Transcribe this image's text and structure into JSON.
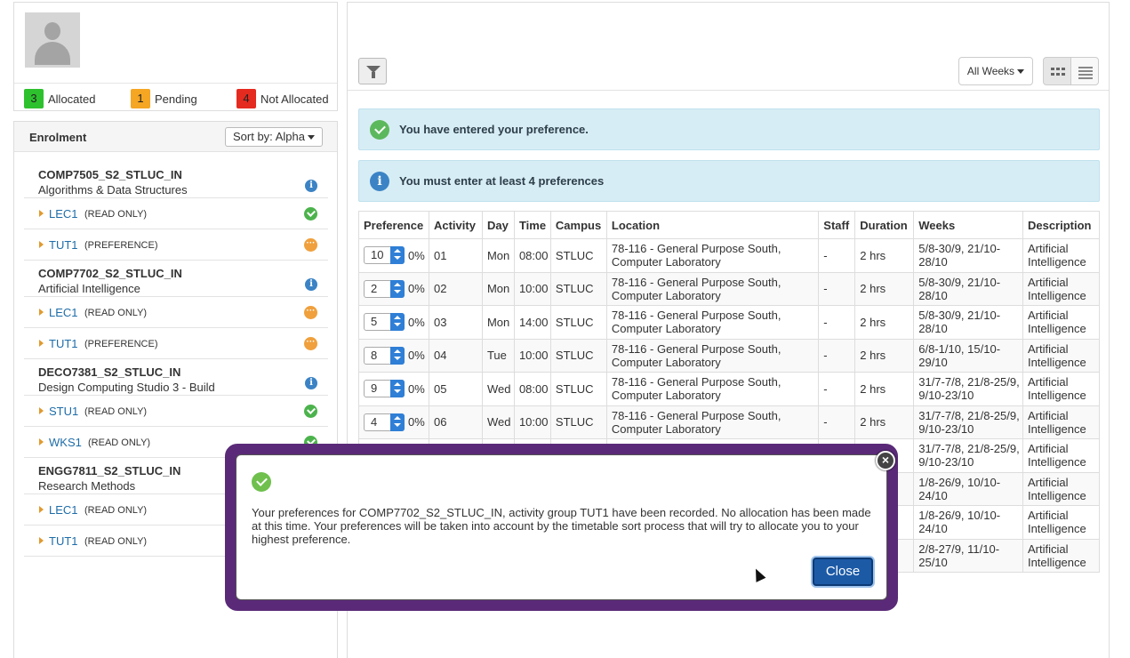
{
  "legend": {
    "allocated": {
      "count": "3",
      "label": "Allocated",
      "color": "#2ec12e"
    },
    "pending": {
      "count": "1",
      "label": "Pending",
      "color": "#f5a623"
    },
    "not_allocated": {
      "count": "4",
      "label": "Not Allocated",
      "color": "#e52a1f"
    }
  },
  "enrolment": {
    "title": "Enrolment",
    "sort_label": "Sort by: Alpha",
    "courses": [
      {
        "code": "COMP7505_S2_STLUC_IN",
        "name": "Algorithms & Data Structures",
        "activities": [
          {
            "name": "LEC1",
            "mode": "(READ ONLY)",
            "status": "allocated"
          },
          {
            "name": "TUT1",
            "mode": "(PREFERENCE)",
            "status": "pending"
          }
        ]
      },
      {
        "code": "COMP7702_S2_STLUC_IN",
        "name": "Artificial Intelligence",
        "activities": [
          {
            "name": "LEC1",
            "mode": "(READ ONLY)",
            "status": "pending"
          },
          {
            "name": "TUT1",
            "mode": "(PREFERENCE)",
            "status": "pending"
          }
        ]
      },
      {
        "code": "DECO7381_S2_STLUC_IN",
        "name": "Design Computing Studio 3 - Build",
        "activities": [
          {
            "name": "STU1",
            "mode": "(READ ONLY)",
            "status": "allocated"
          },
          {
            "name": "WKS1",
            "mode": "(READ ONLY)",
            "status": "allocated"
          }
        ]
      },
      {
        "code": "ENGG7811_S2_STLUC_IN",
        "name": "Research Methods",
        "activities": [
          {
            "name": "LEC1",
            "mode": "(READ ONLY)",
            "status": "allocated"
          },
          {
            "name": "TUT1",
            "mode": "(READ ONLY)",
            "status": "allocated"
          }
        ]
      }
    ]
  },
  "toolbar": {
    "weeks_label": "All Weeks"
  },
  "alerts": {
    "success": "You have entered your preference.",
    "info": "You must enter at least 4 preferences"
  },
  "table": {
    "headers": [
      "Preference",
      "Activity",
      "Day",
      "Time",
      "Campus",
      "Location",
      "Staff",
      "Duration",
      "Weeks",
      "Description"
    ],
    "rows": [
      {
        "pref": "10",
        "pct": "0%",
        "activity": "01",
        "day": "Mon",
        "time": "08:00",
        "campus": "STLUC",
        "location": "78-116 - General Purpose South, Computer Laboratory",
        "staff": "-",
        "duration": "2 hrs",
        "weeks": "5/8-30/9, 21/10-28/10",
        "desc": "Artificial Intelligence"
      },
      {
        "pref": "2",
        "pct": "0%",
        "activity": "02",
        "day": "Mon",
        "time": "10:00",
        "campus": "STLUC",
        "location": "78-116 - General Purpose South, Computer Laboratory",
        "staff": "-",
        "duration": "2 hrs",
        "weeks": "5/8-30/9, 21/10-28/10",
        "desc": "Artificial Intelligence"
      },
      {
        "pref": "5",
        "pct": "0%",
        "activity": "03",
        "day": "Mon",
        "time": "14:00",
        "campus": "STLUC",
        "location": "78-116 - General Purpose South, Computer Laboratory",
        "staff": "-",
        "duration": "2 hrs",
        "weeks": "5/8-30/9, 21/10-28/10",
        "desc": "Artificial Intelligence"
      },
      {
        "pref": "8",
        "pct": "0%",
        "activity": "04",
        "day": "Tue",
        "time": "10:00",
        "campus": "STLUC",
        "location": "78-116 - General Purpose South, Computer Laboratory",
        "staff": "-",
        "duration": "2 hrs",
        "weeks": "6/8-1/10, 15/10-29/10",
        "desc": "Artificial Intelligence"
      },
      {
        "pref": "9",
        "pct": "0%",
        "activity": "05",
        "day": "Wed",
        "time": "08:00",
        "campus": "STLUC",
        "location": "78-116 - General Purpose South, Computer Laboratory",
        "staff": "-",
        "duration": "2 hrs",
        "weeks": "31/7-7/8, 21/8-25/9, 9/10-23/10",
        "desc": "Artificial Intelligence"
      },
      {
        "pref": "4",
        "pct": "0%",
        "activity": "06",
        "day": "Wed",
        "time": "10:00",
        "campus": "STLUC",
        "location": "78-116 - General Purpose South, Computer Laboratory",
        "staff": "-",
        "duration": "2 hrs",
        "weeks": "31/7-7/8, 21/8-25/9, 9/10-23/10",
        "desc": "Artificial Intelligence"
      },
      {
        "pref": "",
        "pct": "",
        "activity": "",
        "day": "",
        "time": "",
        "campus": "",
        "location": "",
        "staff": "",
        "duration": "",
        "weeks": "31/7-7/8, 21/8-25/9, 9/10-23/10",
        "desc": "Artificial Intelligence"
      },
      {
        "pref": "",
        "pct": "",
        "activity": "",
        "day": "",
        "time": "",
        "campus": "",
        "location": "",
        "staff": "",
        "duration": "",
        "weeks": "1/8-26/9, 10/10-24/10",
        "desc": "Artificial Intelligence"
      },
      {
        "pref": "",
        "pct": "",
        "activity": "",
        "day": "",
        "time": "",
        "campus": "",
        "location": "",
        "staff": "",
        "duration": "",
        "weeks": "1/8-26/9, 10/10-24/10",
        "desc": "Artificial Intelligence"
      },
      {
        "pref": "",
        "pct": "",
        "activity": "",
        "day": "",
        "time": "",
        "campus": "",
        "location": "",
        "staff": "",
        "duration": "",
        "weeks": "2/8-27/9, 11/10-25/10",
        "desc": "Artificial Intelligence"
      }
    ]
  },
  "modal": {
    "message": "Your preferences for COMP7702_S2_STLUC_IN, activity group TUT1 have been recorded. No allocation has been made at this time. Your preferences will be taken into account by the timetable sort process that will try to allocate you to your highest preference.",
    "close_label": "Close",
    "close_x": "×"
  }
}
